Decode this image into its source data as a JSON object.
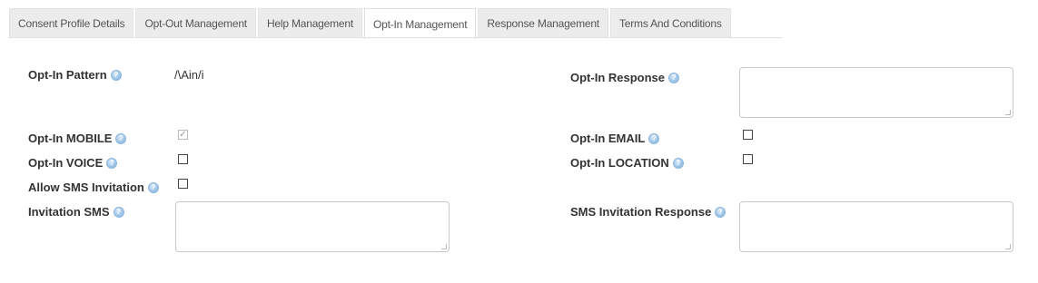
{
  "tabs": [
    {
      "label": "Consent Profile Details"
    },
    {
      "label": "Opt-Out Management"
    },
    {
      "label": "Help Management"
    },
    {
      "label": "Opt-In Management"
    },
    {
      "label": "Response Management"
    },
    {
      "label": "Terms And Conditions"
    }
  ],
  "active_tab": "Opt-In Management",
  "help_icon": "question-help-icon",
  "form": {
    "opt_in_pattern": {
      "label": "Opt-In Pattern",
      "value": "/\\Ain/i"
    },
    "opt_in_response": {
      "label": "Opt-In Response",
      "value": ""
    },
    "opt_in_mobile": {
      "label": "Opt-In MOBILE",
      "checked": true,
      "disabled": true
    },
    "opt_in_email": {
      "label": "Opt-In EMAIL",
      "checked": false
    },
    "opt_in_voice": {
      "label": "Opt-In VOICE",
      "checked": false
    },
    "opt_in_location": {
      "label": "Opt-In LOCATION",
      "checked": false
    },
    "allow_sms_invitation": {
      "label": "Allow SMS Invitation",
      "checked": false
    },
    "invitation_sms": {
      "label": "Invitation SMS",
      "value": ""
    },
    "sms_invitation_response": {
      "label": "SMS Invitation Response",
      "value": ""
    }
  }
}
